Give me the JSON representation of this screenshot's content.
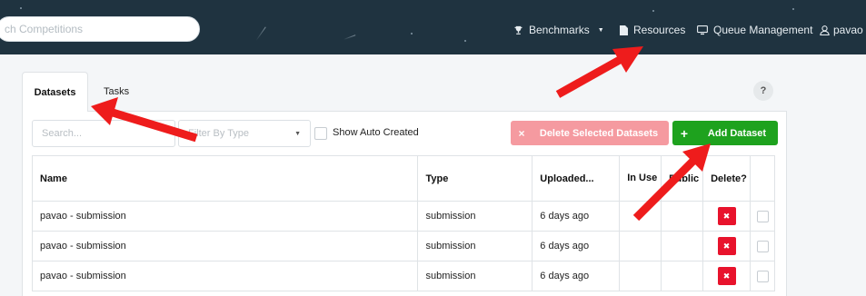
{
  "navbar": {
    "search": {
      "value": "",
      "placeholder": "ch Competitions"
    },
    "items": [
      {
        "label": "Benchmarks",
        "icon": "trophy-icon",
        "has_dropdown": true
      },
      {
        "label": "Resources",
        "icon": "file-icon"
      },
      {
        "label": "Queue Management",
        "icon": "monitor-icon"
      },
      {
        "label": "pavao",
        "icon": "user-icon"
      }
    ]
  },
  "tabs": [
    {
      "label": "Datasets",
      "active": true
    },
    {
      "label": "Tasks",
      "active": false
    }
  ],
  "help": {
    "label": "?"
  },
  "toolbar": {
    "search_placeholder": "Search...",
    "filter_placeholder": "Filter By Type",
    "show_auto_created_label": "Show Auto Created",
    "delete_selected_label": "Delete Selected Datasets",
    "delete_selected_icon": "×",
    "add_dataset_label": "Add Dataset",
    "add_dataset_icon": "+"
  },
  "table": {
    "columns": [
      "Name",
      "Type",
      "Uploaded...",
      "In Use",
      "Public",
      "Delete?"
    ],
    "rows": [
      {
        "name": "pavao - submission",
        "type": "submission",
        "uploaded": "6 days ago",
        "in_use": "",
        "public": ""
      },
      {
        "name": "pavao - submission",
        "type": "submission",
        "uploaded": "6 days ago",
        "in_use": "",
        "public": ""
      },
      {
        "name": "pavao - submission",
        "type": "submission",
        "uploaded": "6 days ago",
        "in_use": "",
        "public": ""
      }
    ],
    "delete_row_icon": "✖"
  },
  "colors": {
    "navbar_bg": "#1f3340",
    "delete_selected_bg": "#f59aa0",
    "add_dataset_bg": "#1ea21e",
    "row_delete_bg": "#e8132c",
    "annotation_arrow": "#ee1c1c"
  }
}
